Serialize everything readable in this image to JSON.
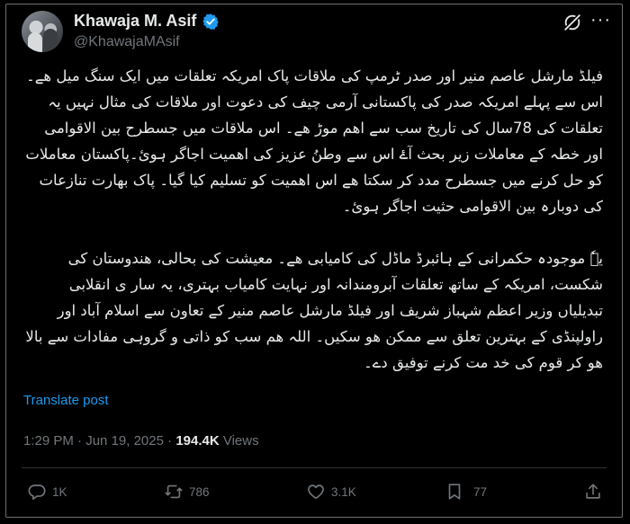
{
  "author": {
    "name": "Khawaja M. Asif",
    "handle": "@KhawajaMAsif"
  },
  "tweet": {
    "paragraphs": [
      "فیلڈ مارشل عاصم منیر اور صدر ٹرمپ کی ملاقات پاک امریکہ تعلقات میں ایک سنگ میل ھے۔ اس سے پہلے امریکہ صدر کی پاکستانی آرمی چیف کی دعوت اور ملاقات کی مثال نہیں یہ تعلقات کی 78سال کی تاریخ سب سے اھم موڑ ھے۔ اس ملاقات میں جسطرح بین الاقوامی اور خطہ کے معاملات زیر بحث آۓ اس سے وطنُ عزیز کی اھمیت اجاگر ہوئ۔پاکستان معاملات کو حل کرنے میں جسطرح مدد کر سکتا ھے اس اھمیت کو تسلیم کیا گیا۔ پاک بھارت تنازعات کی دوبارہ بین الاقوامی حثیت اجاگر ہوئ۔",
      "یہٗ موجودہ حکمرانی کے ہائبرڈ ماڈل کی کامیابی ھے۔ معیشت کی بحالی، ھندوستان کی شکست، امریکہ کے ساتھ تعلقات آبرومندانہ اور نہایت کامیاب بہتری، یہ سار ی انقلابی تبدیلیاں وزیر اعظم شہباز شریف اور فیلڈ مارشل عاصم منیر کے تعاون سے اسلام آباد اور راولپنڈی کے بہترین تعلق سے ممکن ھو سکیں۔ اللہ ھم سب کو ذاتی و گروہی مفادات سے بالا ھو کر قوم کی خد مت کرنے توفیق دے۔"
    ],
    "translate_label": "Translate post",
    "time": "1:29 PM",
    "separator": " · ",
    "date": "Jun 19, 2025",
    "views_count": "194.4K",
    "views_label": " Views"
  },
  "actions": {
    "replies": "1K",
    "reposts": "786",
    "likes": "3.1K",
    "bookmarks": "77"
  },
  "colors": {
    "background": "#000000",
    "text": "#e7e9ea",
    "muted": "#71767b",
    "link": "#1d9bf0",
    "verified": "#1d9bf0"
  },
  "icons": [
    "verified-badge-icon",
    "grok-icon",
    "more-icon",
    "reply-icon",
    "repost-icon",
    "like-icon",
    "bookmark-icon",
    "share-icon"
  ]
}
